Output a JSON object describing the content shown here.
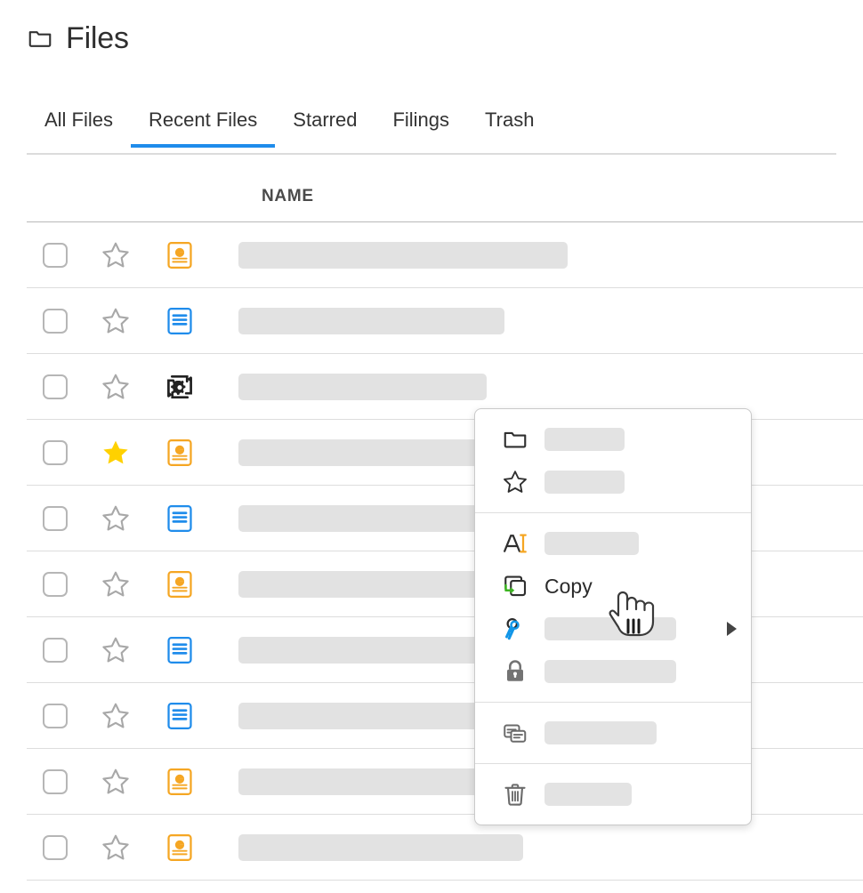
{
  "header": {
    "title": "Files",
    "icon": "folder-icon"
  },
  "tabs": [
    {
      "label": "All Files",
      "active": false
    },
    {
      "label": "Recent Files",
      "active": true
    },
    {
      "label": "Starred",
      "active": false
    },
    {
      "label": "Filings",
      "active": false
    },
    {
      "label": "Trash",
      "active": false
    }
  ],
  "table": {
    "columns": [
      "NAME"
    ],
    "name_header": "NAME",
    "rows": [
      {
        "checked": false,
        "starred": false,
        "file_icon": "presentation-icon",
        "name_bar_width": 370
      },
      {
        "checked": false,
        "starred": false,
        "file_icon": "document-icon",
        "name_bar_width": 299
      },
      {
        "checked": false,
        "starred": false,
        "file_icon": "process-gear-icon",
        "name_bar_width": 279
      },
      {
        "checked": false,
        "starred": true,
        "file_icon": "presentation-icon",
        "name_bar_width": 316
      },
      {
        "checked": false,
        "starred": false,
        "file_icon": "document-icon",
        "name_bar_width": 316
      },
      {
        "checked": false,
        "starred": false,
        "file_icon": "presentation-icon",
        "name_bar_width": 310
      },
      {
        "checked": false,
        "starred": false,
        "file_icon": "document-icon",
        "name_bar_width": 310
      },
      {
        "checked": false,
        "starred": false,
        "file_icon": "document-icon",
        "name_bar_width": 305
      },
      {
        "checked": false,
        "starred": false,
        "file_icon": "presentation-icon",
        "name_bar_width": 290
      },
      {
        "checked": false,
        "starred": false,
        "file_icon": "presentation-icon",
        "name_bar_width": 320
      }
    ]
  },
  "context_menu": {
    "groups": [
      {
        "items": [
          {
            "icon": "folder-open-icon",
            "label": "",
            "label_bar_width": 90,
            "submenu": false
          },
          {
            "icon": "star-outline-icon",
            "label": "",
            "label_bar_width": 90,
            "submenu": false
          }
        ]
      },
      {
        "items": [
          {
            "icon": "rename-icon",
            "label": "",
            "label_bar_width": 106,
            "submenu": false
          },
          {
            "icon": "copy-icon",
            "label": "Copy",
            "label_bar_width": 0,
            "submenu": false
          },
          {
            "icon": "keys-icon",
            "label": "",
            "label_bar_width": 148,
            "submenu": true
          },
          {
            "icon": "lock-icon",
            "label": "",
            "label_bar_width": 148,
            "submenu": false
          }
        ]
      },
      {
        "items": [
          {
            "icon": "properties-card-icon",
            "label": "",
            "label_bar_width": 126,
            "submenu": false
          }
        ]
      },
      {
        "items": [
          {
            "icon": "trash-icon",
            "label": "",
            "label_bar_width": 98,
            "submenu": false
          }
        ]
      }
    ]
  },
  "cursor": {
    "type": "pointing-hand-cursor"
  },
  "colors": {
    "accent_blue": "#1f8ceb",
    "star_gold": "#ffd100",
    "presentation_orange": "#f5a623",
    "document_blue": "#1f8ceb",
    "copy_green": "#3cb521",
    "keys_blue": "#1296e8",
    "lock_gray": "#737373",
    "placeholder_gray": "#e2e2e2",
    "row_border": "#dddddd"
  }
}
